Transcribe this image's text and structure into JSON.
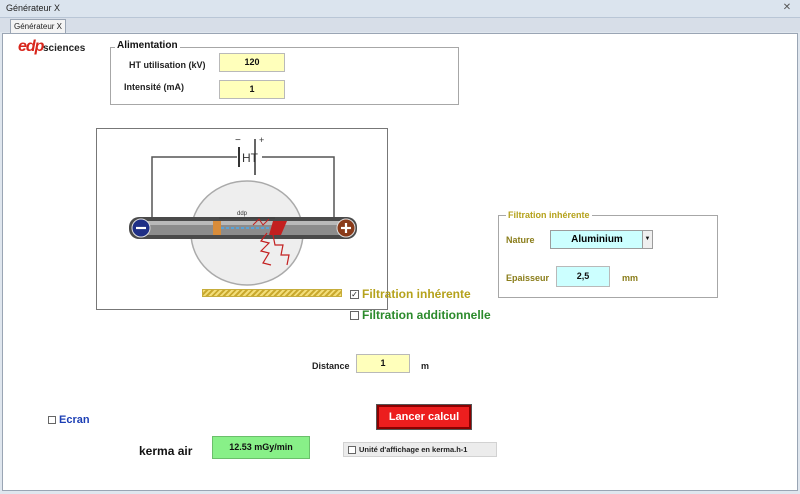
{
  "window": {
    "title": "Générateur X",
    "close_glyph": "✕"
  },
  "tabs": [
    {
      "label": "Générateur X"
    }
  ],
  "logo": {
    "edp": "edp",
    "sciences": "sciences"
  },
  "alimentation": {
    "legend": "Alimentation",
    "ht_label": "HT utilisation (kV)",
    "ht_value": "120",
    "intensity_label": "Intensité (mA)",
    "intensity_value": "1"
  },
  "diagram": {
    "ht_label": "HT",
    "minus": "−",
    "plus": "+",
    "dist_label": "ddp"
  },
  "filtration_inherente": {
    "legend": "Filtration inhérente",
    "nature_label": "Nature",
    "nature_value": "Aluminium",
    "epaisseur_label": "Epaisseur",
    "epaisseur_value": "2,5",
    "epaisseur_unit": "mm"
  },
  "checks": {
    "filtration_inherente": {
      "label": "Filtration inhérente",
      "checked": true,
      "glyph": "✓"
    },
    "filtration_additionnelle": {
      "label": "Filtration additionnelle",
      "checked": false
    },
    "ecran": {
      "label": "Ecran",
      "checked": false
    },
    "unite": {
      "label": "Unité d'affichage en kerma.h-1",
      "checked": false
    }
  },
  "distance": {
    "label": "Distance",
    "value": "1",
    "unit": "m"
  },
  "launch_button": {
    "label": "Lancer calcul"
  },
  "kerma": {
    "label": "kerma air",
    "value": "12.53 mGy/min"
  },
  "colors": {
    "field_yellow": "#ffffbb",
    "field_cyan": "#ccffff",
    "kerma_green": "#88f088",
    "launch_red": "#ec1e1e",
    "legend_gold": "#b5a21c"
  }
}
